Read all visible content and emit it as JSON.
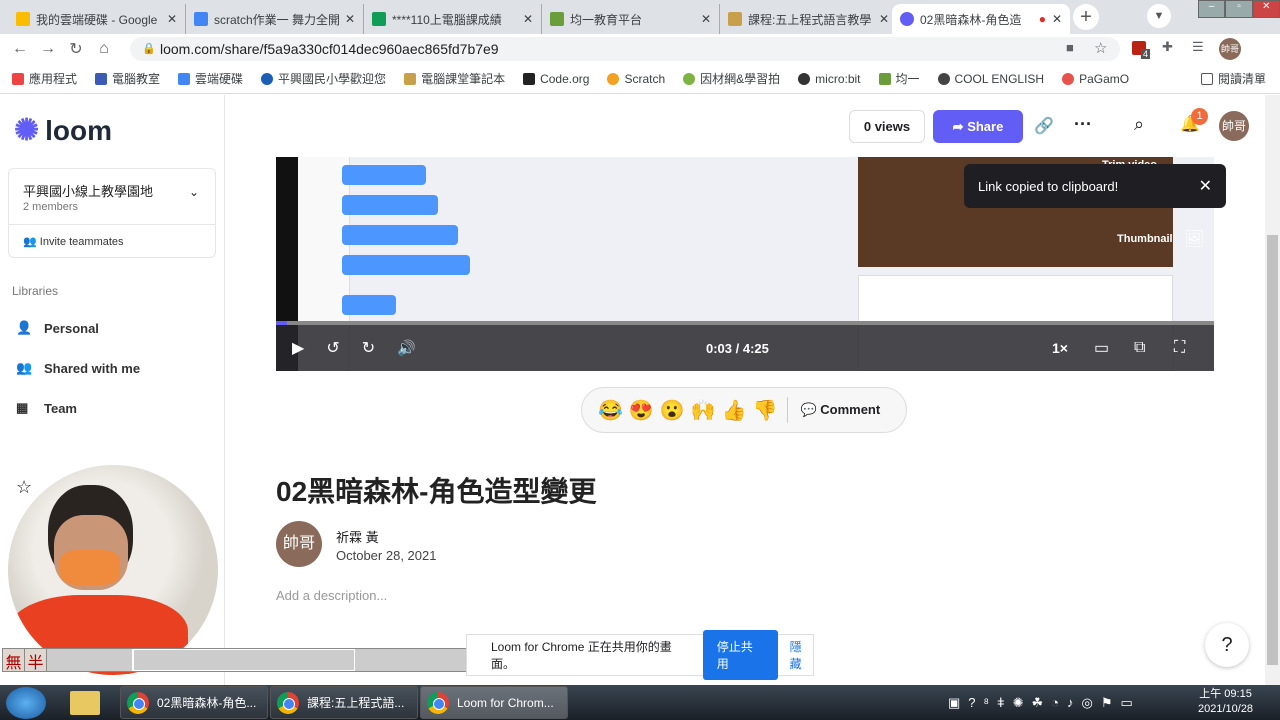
{
  "browser": {
    "tabs": [
      {
        "title": "我的雲端硬碟 - Google",
        "color": "#fbbc04"
      },
      {
        "title": "scratch作業一 舞力全開",
        "color": "#4285f4"
      },
      {
        "title": "****110上電腦課成績",
        "color": "#0f9d58"
      },
      {
        "title": "均一教育平台",
        "color": "#6b9e3a"
      },
      {
        "title": "課程:五上程式語言教學",
        "color": "#c9a04a"
      },
      {
        "title": "02黑暗森林-角色造",
        "color": "#625df5"
      }
    ],
    "url": "loom.com/share/f5a9a330cf014dec960aec865fd7b7e9",
    "bookmarks": [
      "應用程式",
      "電腦教室",
      "雲端硬碟",
      "平興國民小學歡迎您",
      "電腦課堂筆記本",
      "Code.org",
      "Scratch",
      "因材網&學習拍",
      "micro:bit",
      "均一",
      "COOL ENGLISH",
      "PaGamO"
    ],
    "reading_list": "閱讀清單",
    "ext_badge": "4",
    "profile": "帥哥"
  },
  "sidebar": {
    "logo": "loom",
    "workspace": "平興國小線上教學園地",
    "members": "2 members",
    "invite": "Invite teammates",
    "libraries": "Libraries",
    "items": [
      "Personal",
      "Shared with me",
      "Team"
    ]
  },
  "header": {
    "views": "0 views",
    "share": "Share",
    "notif_count": "1",
    "avatar": "帥哥"
  },
  "video": {
    "time": "0:03 / 4:25",
    "speed": "1×",
    "progress": 0.012,
    "thumbnail": "Thumbnail",
    "trim": "Trim video"
  },
  "toast": "Link copied to clipboard!",
  "reactions": [
    "😂",
    "😍",
    "😮",
    "🙌",
    "👍",
    "👎"
  ],
  "comment": "Comment",
  "page": {
    "title": "02黑暗森林-角色造型變更",
    "author": "祈霖 黃",
    "date": "October 28, 2021",
    "desc_placeholder": "Add a description...",
    "help": "?"
  },
  "share_bar": {
    "text": "Loom for Chrome 正在共用你的畫面。",
    "stop": "停止共用",
    "hide": "隱藏"
  },
  "ime": [
    "無",
    "半"
  ],
  "taskbar": {
    "items": [
      "02黑暗森林-角色...",
      "課程:五上程式語...",
      "Loom for Chrom..."
    ],
    "time": "上午 09:15",
    "date": "2021/10/28"
  }
}
